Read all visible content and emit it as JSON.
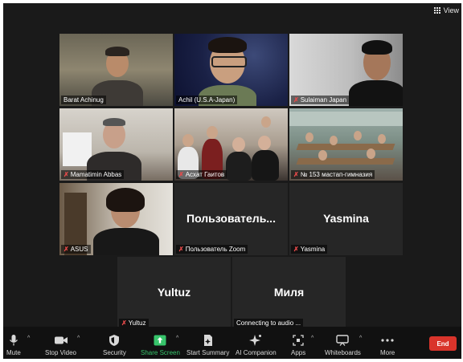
{
  "header": {
    "view_label": "View"
  },
  "participants": [
    {
      "name": "Barat Achinug",
      "muted": false,
      "video": true
    },
    {
      "name": "Achil (U.S.A-Japan)",
      "muted": false,
      "video": true
    },
    {
      "name": "Sulaiman Japan",
      "muted": true,
      "video": true
    },
    {
      "name": "Mamatimin Abbas",
      "muted": true,
      "video": true
    },
    {
      "name": "Асхат Гаитов",
      "muted": true,
      "video": true
    },
    {
      "name": "№ 153 мастап-гимназия",
      "muted": true,
      "video": true
    },
    {
      "name": "ASUS",
      "muted": true,
      "video": true
    },
    {
      "name": "Пользователь Zoom",
      "display": "Пользователь...",
      "muted": true,
      "video": false
    },
    {
      "name": "Yasmina",
      "display": "Yasmina",
      "muted": true,
      "video": false
    },
    {
      "name": "Yultuz",
      "display": "Yultuz",
      "muted": true,
      "video": false
    },
    {
      "name": "Connecting to audio ...",
      "display": "Миля",
      "muted": false,
      "video": false
    }
  ],
  "toolbar": {
    "mute": "Mute",
    "stop_video": "Stop Video",
    "security": "Security",
    "share_screen": "Share Screen",
    "start_summary": "Start Summary",
    "ai_companion": "AI Companion",
    "apps": "Apps",
    "whiteboards": "Whiteboards",
    "more": "More",
    "end": "End"
  },
  "colors": {
    "share_green": "#37c46b",
    "end_red": "#d9342b",
    "active_border": "#e6e07a"
  }
}
